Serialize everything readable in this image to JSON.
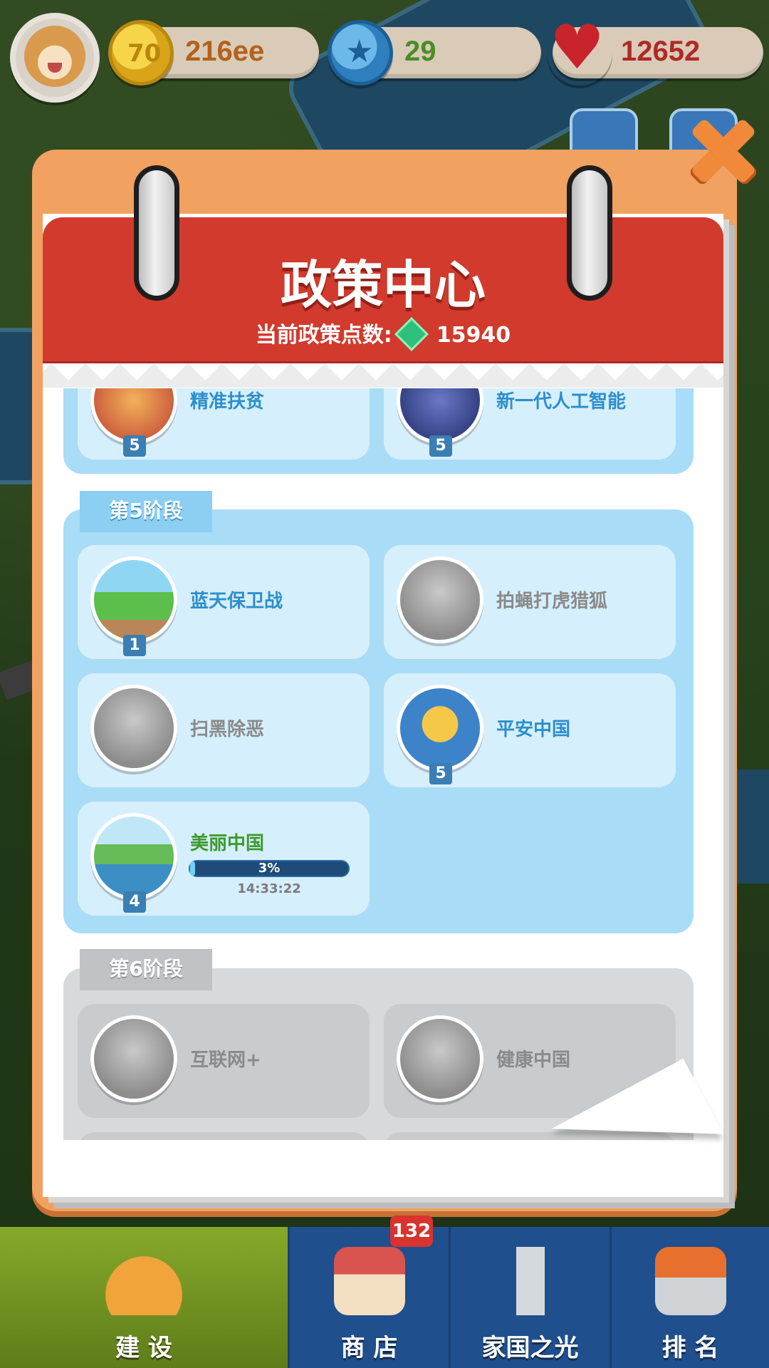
{
  "topbar": {
    "coins": "216ee",
    "stars": "29",
    "hearts": "12652",
    "coin_glyph": "70"
  },
  "panel": {
    "title": "政策中心",
    "points_label": "当前政策点数:",
    "points_value": "15940"
  },
  "stages": [
    {
      "label": "",
      "items": [
        {
          "name": "精准扶贫",
          "level": "5",
          "state": "unlocked"
        },
        {
          "name": "新一代人工智能",
          "level": "5",
          "state": "unlocked"
        }
      ]
    },
    {
      "label": "第5阶段",
      "items": [
        {
          "name": "蓝天保卫战",
          "level": "1",
          "state": "unlocked"
        },
        {
          "name": "拍蝇打虎猎狐",
          "level": "",
          "state": "locked"
        },
        {
          "name": "扫黑除恶",
          "level": "",
          "state": "locked"
        },
        {
          "name": "平安中国",
          "level": "5",
          "state": "unlocked"
        },
        {
          "name": "美丽中国",
          "level": "4",
          "state": "in-progress",
          "progress": "3%",
          "progress_value": 0.03,
          "timer": "14:33:22"
        }
      ]
    },
    {
      "label": "第6阶段",
      "items": [
        {
          "name": "互联网+",
          "level": "",
          "state": "locked"
        },
        {
          "name": "健康中国",
          "level": "",
          "state": "locked"
        }
      ]
    }
  ],
  "nav": {
    "items": [
      {
        "label": "建 设",
        "active": true
      },
      {
        "label": "商 店",
        "badge": "132"
      },
      {
        "label": "家国之光"
      },
      {
        "label": "排 名"
      }
    ]
  },
  "colors": {
    "header_red": "#d13a2d",
    "frame_orange": "#f1a160",
    "stage_active": "#a9dcf7",
    "stage_locked": "#d6dadc",
    "nav_blue": "#1f4f8c",
    "nav_active": "#7a9b24"
  },
  "icons": {
    "close": "close-icon",
    "gem": "gem-icon",
    "coin": "coin-icon",
    "star": "star-icon",
    "heart": "heart-icon"
  }
}
